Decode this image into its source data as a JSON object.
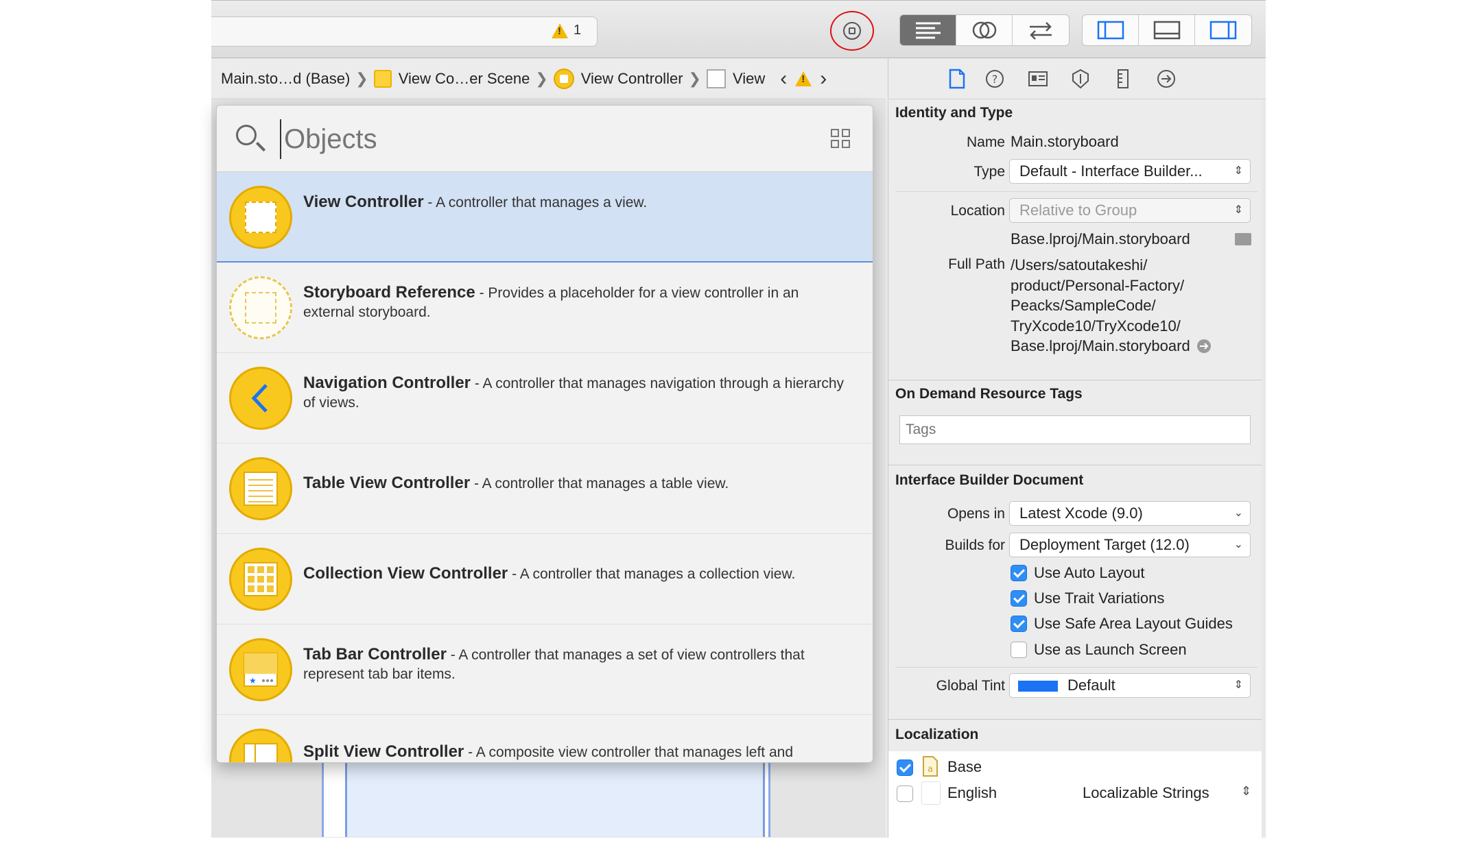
{
  "toolbar": {
    "warning_count": "1",
    "icons": [
      "warning-icon",
      "library-icon",
      "standard-editor-icon",
      "assistant-editor-icon",
      "version-editor-icon",
      "navigator-toggle-icon",
      "debug-area-toggle-icon",
      "utilities-toggle-icon"
    ]
  },
  "jumpbar": {
    "items": [
      "Main.sto…d (Base)",
      "View Co…er Scene",
      "View Controller",
      "View"
    ]
  },
  "library": {
    "search_placeholder": "Objects",
    "items": [
      {
        "title": "View Controller",
        "desc": " - A controller that manages a view.",
        "icon": "view-controller-icon",
        "selected": true
      },
      {
        "title": "Storyboard Reference",
        "desc": " - Provides a placeholder for a view controller in an external storyboard.",
        "icon": "storyboard-reference-icon",
        "selected": false
      },
      {
        "title": "Navigation Controller",
        "desc": " - A controller that manages navigation through a hierarchy of views.",
        "icon": "navigation-controller-icon",
        "selected": false
      },
      {
        "title": "Table View Controller",
        "desc": " - A controller that manages a table view.",
        "icon": "table-view-controller-icon",
        "selected": false
      },
      {
        "title": "Collection View Controller",
        "desc": " - A controller that manages a collection view.",
        "icon": "collection-view-controller-icon",
        "selected": false
      },
      {
        "title": "Tab Bar Controller",
        "desc": " - A controller that manages a set of view controllers that represent tab bar items.",
        "icon": "tab-bar-controller-icon",
        "selected": false
      },
      {
        "title": "Split View Controller",
        "desc": " - A composite view controller that manages left and",
        "icon": "split-view-controller-icon",
        "selected": false
      }
    ]
  },
  "inspector": {
    "identity": {
      "title": "Identity and Type",
      "name_label": "Name",
      "name_value": "Main.storyboard",
      "type_label": "Type",
      "type_value": "Default - Interface Builder...",
      "location_label": "Location",
      "location_value": "Relative to Group",
      "file_value": "Base.lproj/Main.storyboard",
      "fullpath_label": "Full Path",
      "fullpath_lines": [
        "/Users/satoutakeshi/",
        "product/Personal-Factory/",
        "Peacks/SampleCode/",
        "TryXcode10/TryXcode10/",
        "Base.lproj/Main.storyboard"
      ]
    },
    "odr": {
      "title": "On Demand Resource Tags",
      "tags_placeholder": "Tags"
    },
    "ibdoc": {
      "title": "Interface Builder Document",
      "opens_label": "Opens in",
      "opens_value": "Latest Xcode (9.0)",
      "builds_label": "Builds for",
      "builds_value": "Deployment Target (12.0)",
      "checks": [
        {
          "label": "Use Auto Layout",
          "checked": true
        },
        {
          "label": "Use Trait Variations",
          "checked": true
        },
        {
          "label": "Use Safe Area Layout Guides",
          "checked": true
        },
        {
          "label": "Use as Launch Screen",
          "checked": false
        }
      ],
      "tint_label": "Global Tint",
      "tint_value": "Default",
      "tint_color": "#1a73f5"
    },
    "localization": {
      "title": "Localization",
      "items": [
        {
          "label": "Base",
          "checked": true
        },
        {
          "label": "English",
          "checked": false,
          "mode": "Localizable Strings"
        }
      ]
    }
  },
  "colors": {
    "accent": "#2f8ef5",
    "library_icon": "#f8c81f",
    "selection": "#d3e1f4",
    "highlight_ring": "#dd1111"
  }
}
